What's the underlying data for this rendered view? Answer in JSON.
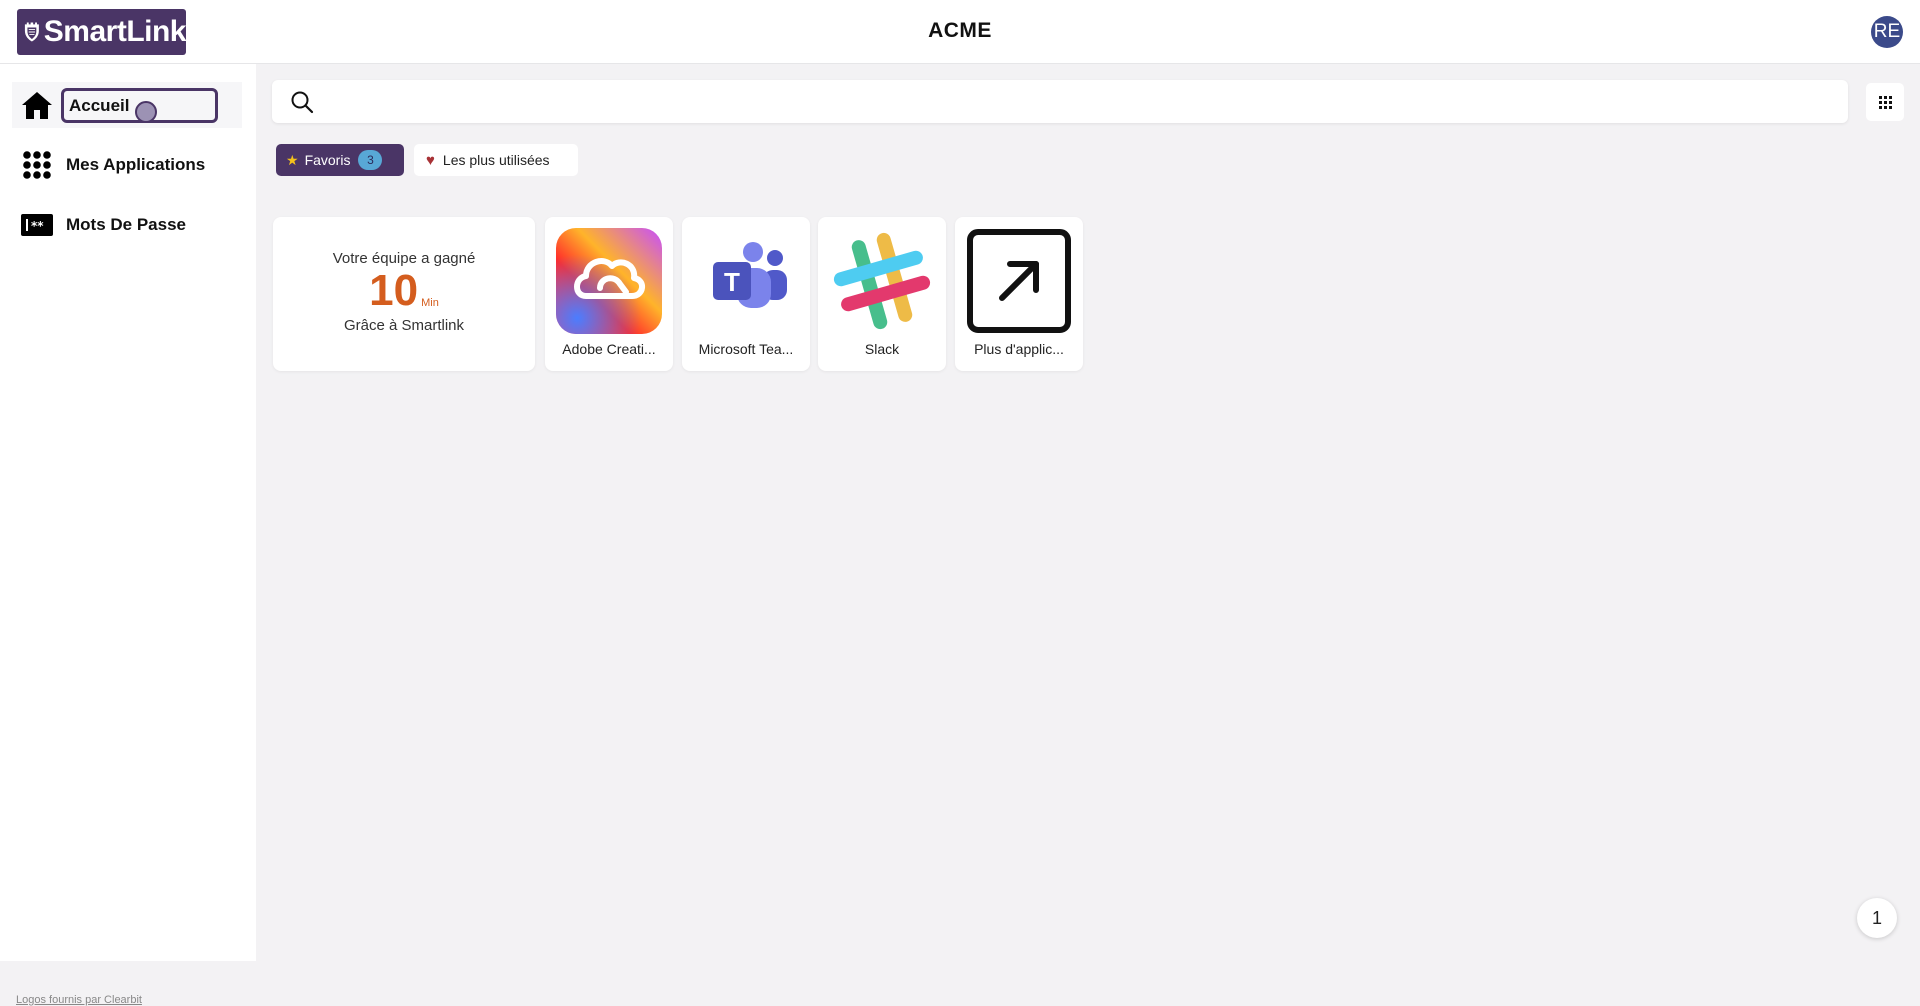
{
  "header": {
    "logo_text": "SmartLink",
    "title": "ACME",
    "avatar_initials": "RE"
  },
  "sidebar": {
    "items": [
      {
        "label": "Accueil",
        "icon": "home-icon",
        "active": true
      },
      {
        "label": "Mes Applications",
        "icon": "apps-grid-icon",
        "active": false
      },
      {
        "label": "Mots De Passe",
        "icon": "password-icon",
        "active": false
      }
    ],
    "footer_link": "Logos fournis par Clearbit"
  },
  "search": {
    "placeholder": "",
    "value": "",
    "icon": "search-icon"
  },
  "view_toggle": {
    "icon": "grid-view-icon"
  },
  "filters": {
    "favorites": {
      "label": "Favoris",
      "count": "3",
      "icon": "star-icon"
    },
    "most_used": {
      "label": "Les plus utilisées",
      "icon": "heart-icon"
    }
  },
  "stat_card": {
    "line1": "Votre équipe a gagné",
    "value": "10",
    "unit": "Min",
    "line2": "Grâce à Smartlink"
  },
  "apps": [
    {
      "name": "Adobe Creati...",
      "icon": "adobe-creative-cloud-icon"
    },
    {
      "name": "Microsoft Tea...",
      "icon": "microsoft-teams-icon"
    },
    {
      "name": "Slack",
      "icon": "slack-icon"
    },
    {
      "name": "Plus d'applic...",
      "icon": "external-link-icon"
    }
  ],
  "notification_badge": "1",
  "colors": {
    "brand": "#4a3566",
    "accent_orange": "#d45d1e",
    "badge_blue": "#58a8d6"
  }
}
